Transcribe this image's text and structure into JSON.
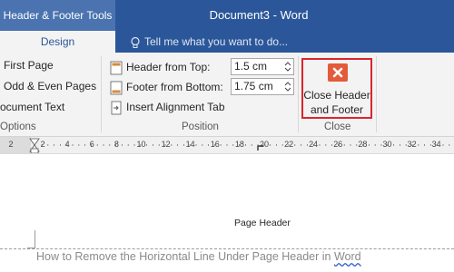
{
  "titlebar": {
    "context_tools": "Header & Footer Tools",
    "document_title": "Document3 - Word",
    "bg_color": "#2b579a"
  },
  "tabs": {
    "active": "Design",
    "tell_me": "Tell me what you want to do...",
    "tell_me_icon": "lightbulb-icon"
  },
  "options_group": {
    "items": [
      "First Page",
      "Odd & Even Pages",
      "ocument Text"
    ],
    "label": "Options"
  },
  "position_group": {
    "header_from_top_label": "Header from Top:",
    "header_from_top_value": "1.5 cm",
    "footer_from_bottom_label": "Footer from Bottom:",
    "footer_from_bottom_value": "1.75 cm",
    "insert_alignment_tab": "Insert Alignment Tab",
    "label": "Position"
  },
  "close_group": {
    "button_line1": "Close Header",
    "button_line2": "and Footer",
    "label": "Close",
    "highlight_color": "#d9262c",
    "icon": "close-x-icon"
  },
  "ruler": {
    "numbers": [
      "2",
      "2",
      "4",
      "6",
      "8",
      "10",
      "12",
      "14",
      "16",
      "18",
      "20",
      "22",
      "24",
      "26",
      "28",
      "30",
      "32",
      "34"
    ]
  },
  "document": {
    "header_text": "Page Header",
    "caption_prefix": "How to Remove the Horizontal Line Under Page Header in ",
    "caption_word": "Word"
  }
}
